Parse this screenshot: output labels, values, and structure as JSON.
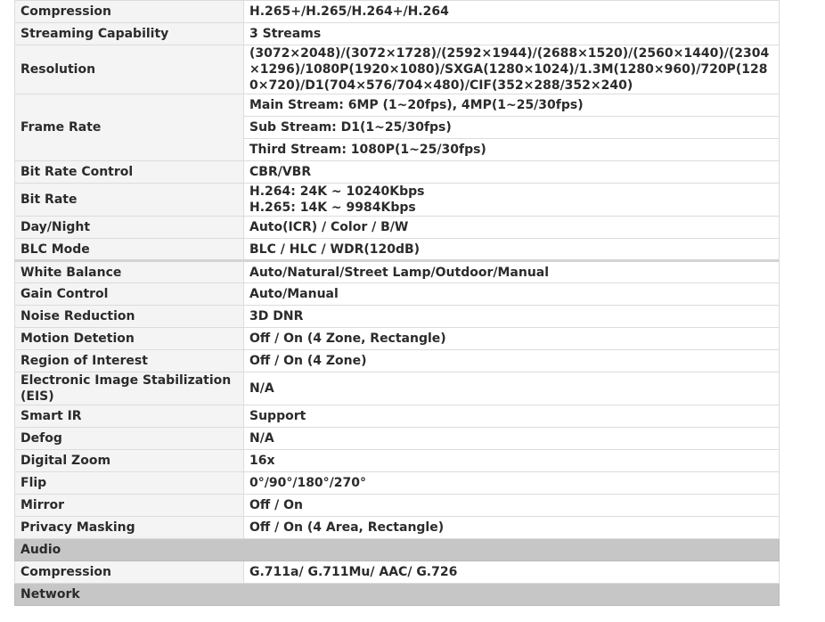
{
  "rows": [
    {
      "label": "Compression",
      "value": "H.265+/H.265/H.264+/H.264"
    },
    {
      "label": "Streaming Capability",
      "value": "3 Streams"
    },
    {
      "label": "Resolution",
      "value": "(3072×2048)/(3072×1728)/(2592×1944)/(2688×1520)/(2560×1440)/(2304×1296)/1080P(1920×1080)/SXGA(1280×1024)/1.3M(1280×960)/720P(1280×720)/D1(704×576/704×480)/CIF(352×288/352×240)"
    },
    {
      "label": "Frame Rate",
      "values": [
        "Main Stream: 6MP (1~20fps), 4MP(1~25/30fps)",
        "Sub Stream: D1(1~25/30fps)",
        "Third Stream: 1080P(1~25/30fps)"
      ]
    },
    {
      "label": "Bit Rate Control",
      "value": "CBR/VBR"
    },
    {
      "label": "Bit Rate",
      "lines": [
        "H.264: 24K ~ 10240Kbps",
        "H.265: 14K ~ 9984Kbps"
      ]
    },
    {
      "label": "Day/Night",
      "value": "Auto(ICR) / Color / B/W"
    },
    {
      "label": "BLC Mode",
      "value": "BLC / HLC / WDR(120dB)"
    },
    {
      "label": "White Balance",
      "value": "Auto/Natural/Street Lamp/Outdoor/Manual"
    },
    {
      "label": "Gain Control",
      "value": "Auto/Manual"
    },
    {
      "label": "Noise Reduction",
      "value": "3D DNR"
    },
    {
      "label": "Motion Detetion",
      "value": "Off / On (4 Zone, Rectangle)"
    },
    {
      "label": "Region of Interest",
      "value": "Off / On (4 Zone)"
    },
    {
      "label": "Electronic Image Stabilization (EIS)",
      "value": "N/A"
    },
    {
      "label": "Smart IR",
      "value": "Support"
    },
    {
      "label": "Defog",
      "value": "N/A"
    },
    {
      "label": "Digital Zoom",
      "value": "16x"
    },
    {
      "label": "Flip",
      "value": "0°/90°/180°/270°"
    },
    {
      "label": "Mirror",
      "value": "Off / On"
    },
    {
      "label": "Privacy Masking",
      "value": "Off / On (4 Area, Rectangle)"
    },
    {
      "section": "Audio"
    },
    {
      "label": "Compression",
      "value": "G.711a/ G.711Mu/ AAC/ G.726"
    },
    {
      "section": "Network"
    }
  ]
}
